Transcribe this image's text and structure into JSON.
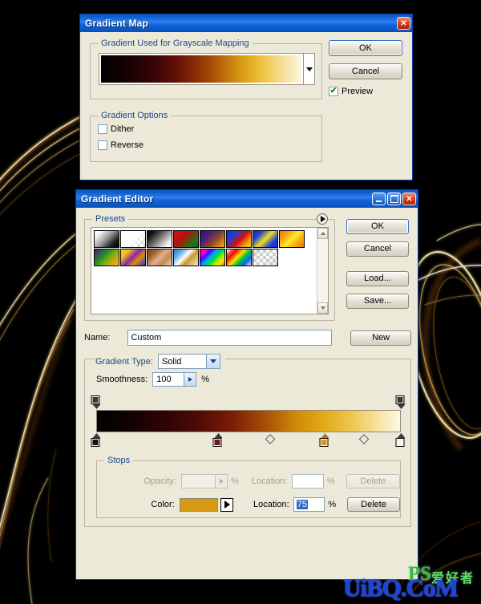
{
  "background": {
    "color": "#000000",
    "streak_colors": [
      "#f6e0a8",
      "#d9a23c",
      "#8c3a10",
      "#ffe9b5"
    ]
  },
  "gradient_map_dialog": {
    "title": "Gradient Map",
    "close_label": "✕",
    "group_gradient": {
      "legend": "Gradient Used for Grayscale Mapping",
      "preview_gradient": "linear-gradient(90deg,#000000 0%,#150202 12%,#3a0508 27%,#6e1406 40%,#a84a05 55%,#d99a13 70%,#edc23d 80%,#f6dd92 90%,#fdf6e0 100%)",
      "dropdown_icon": "chevron-down-icon"
    },
    "group_options": {
      "legend": "Gradient Options",
      "dither_label": "Dither",
      "dither_checked": false,
      "reverse_label": "Reverse",
      "reverse_checked": false
    },
    "ok_label": "OK",
    "cancel_label": "Cancel",
    "preview_label": "Preview",
    "preview_checked": true
  },
  "gradient_editor_dialog": {
    "title": "Gradient Editor",
    "minimize_label": "_",
    "maximize_label": "□",
    "close_label": "✕",
    "presets": {
      "legend": "Presets",
      "menu_icon": "preset-menu-arrow-icon",
      "scroll_up_icon": "scroll-up-arrow-icon",
      "scroll_down_icon": "scroll-down-arrow-icon",
      "swatches": [
        {
          "name": "foreground-to-background",
          "css": "linear-gradient(135deg,#ffffff 0%,#f2f2f2 18%,#9a9a9a 48%,#1c1c1c 78%,#000000 100%)"
        },
        {
          "name": "foreground-to-transparent",
          "css": "linear-gradient(135deg,#ffffff 0%,#ffffff 45%,rgba(255,255,255,0) 100%)",
          "checker": true
        },
        {
          "name": "black-to-white",
          "css": "linear-gradient(135deg,#000000 0%,#1a1a1a 20%,#7d7d7d 50%,#f0f0f0 82%,#ffffff 100%)"
        },
        {
          "name": "red-green",
          "css": "linear-gradient(135deg,#d61212 0%,#b81010 35%,#7a3a08 55%,#1f7a18 80%,#0d5c10 100%)"
        },
        {
          "name": "violet-orange",
          "css": "linear-gradient(135deg,#2a1060 0%,#4b1f7a 30%,#8a4a2a 60%,#e08a10 85%,#f2a51a 100%)"
        },
        {
          "name": "blue-red-yellow",
          "css": "linear-gradient(135deg,#0f2fd0 0%,#1a3ee0 25%,#d01010 55%,#f0a010 80%,#f5d010 100%)"
        },
        {
          "name": "blue-yellow-blue",
          "css": "linear-gradient(135deg,#0f2fd0 0%,#1a3ee0 22%,#f2e01a 50%,#1a3ee0 78%,#0f2fd0 100%)"
        },
        {
          "name": "orange-yellow-orange",
          "css": "linear-gradient(135deg,#f07a0a 0%,#f5a412 25%,#ffe92a 50%,#f5a412 75%,#f07a0a 100%)"
        },
        {
          "name": "violet-green-orange",
          "css": "linear-gradient(135deg,#5a1090 0%,#1f8a2a 35%,#8ab010 62%,#f0a010 85%,#f5c010 100%)"
        },
        {
          "name": "yellow-violet-orange-blue",
          "css": "linear-gradient(135deg,#f5d21a 0%,#f2c018 22%,#8a2aa0 48%,#e08a10 68%,#1a3ac0 100%)"
        },
        {
          "name": "copper",
          "css": "linear-gradient(135deg,#7a4418 0%,#a06030 25%,#e0b08a 50%,#c08a5a 72%,#f0d8bc 100%)"
        },
        {
          "name": "chrome",
          "css": "linear-gradient(135deg,#2a7ad0 0%,#6fb0e8 25%,#ffffff 45%,#c89a28 62%,#f0e8d0 100%)"
        },
        {
          "name": "spectrum",
          "css": "linear-gradient(135deg,#ff0000 0%,#ff00c8 14%,#4000ff 28%,#00a0ff 42%,#00d848 58%,#a8f000 72%,#ffe000 86%,#ff3000 100%)"
        },
        {
          "name": "transparent-rainbow",
          "css": "linear-gradient(135deg,rgba(255,0,0,0) 0%,#ff0000 25%,#ffe000 45%,#00c040 62%,#0060ff 80%,rgba(120,0,255,0) 100%)",
          "checker": true
        },
        {
          "name": "transparent-stripes",
          "css": "linear-gradient(135deg,rgba(200,200,200,0.45) 0%,rgba(255,255,255,0) 50%,rgba(190,190,190,0.4) 100%)",
          "checker": true
        }
      ]
    },
    "ok_label": "OK",
    "cancel_label": "Cancel",
    "load_label": "Load...",
    "save_label": "Save...",
    "name_label": "Name:",
    "name_value": "Custom",
    "new_label": "New",
    "gradient_type_label": "Gradient Type:",
    "gradient_type_value": "Solid",
    "smoothness_label": "Smoothness:",
    "smoothness_value": "100",
    "percent_symbol": "%",
    "gradient_bar": {
      "css": "linear-gradient(90deg,#000000 0%,#0d0102 8%,#280305 20%,#4d0a07 33%,#7c1e05 45%,#a85205 56%,#cf8a0a 66%,#e2ab18 75%,#eec650 84%,#f6e19a 92%,#fdf8e8 100%)",
      "opacity_stops": [
        {
          "name": "opacity-stop-start",
          "location": 0,
          "color": "#3a3a3a"
        },
        {
          "name": "opacity-stop-end",
          "location": 100,
          "color": "#3a3a3a"
        }
      ],
      "color_stops": [
        {
          "name": "color-stop-black",
          "location": 0,
          "color": "#1a1008",
          "selected": false
        },
        {
          "name": "color-stop-darkred",
          "location": 40,
          "color": "#6e1a12",
          "selected": false
        },
        {
          "name": "color-stop-gold",
          "location": 75,
          "color": "#d99a13",
          "selected": true
        },
        {
          "name": "color-stop-cream",
          "location": 100,
          "color": "#fdf6e0",
          "selected": false
        }
      ],
      "midpoints": [
        {
          "location": 57
        },
        {
          "location": 88
        }
      ]
    },
    "stops": {
      "legend": "Stops",
      "opacity_label": "Opacity:",
      "opacity_value": "",
      "opacity_location_label": "Location:",
      "opacity_location_value": "",
      "opacity_delete_label": "Delete",
      "opacity_enabled": false,
      "color_label": "Color:",
      "color_value": "#d99a13",
      "color_location_label": "Location:",
      "color_location_value": "75",
      "color_delete_label": "Delete",
      "percent_symbol": "%"
    }
  },
  "watermark": {
    "text": "UiBQ.CoM",
    "ps_text": "PS",
    "cn_text": "爱好者"
  }
}
